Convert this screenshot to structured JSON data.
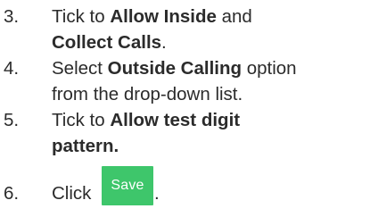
{
  "steps": [
    {
      "number": "3.",
      "lines": [
        {
          "pre": "Tick to ",
          "bold": "Allow Inside",
          "post": " and"
        },
        {
          "pre": "",
          "bold": "Collect Calls",
          "post": "."
        }
      ]
    },
    {
      "number": "4.",
      "lines": [
        {
          "pre": "Select ",
          "bold": "Outside Calling",
          "post": " option"
        },
        {
          "pre": "from the drop-down list.",
          "bold": "",
          "post": ""
        }
      ]
    },
    {
      "number": "5.",
      "lines": [
        {
          "pre": "Tick to ",
          "bold": "Allow test digit",
          "post": ""
        },
        {
          "pre": "",
          "bold": "pattern.",
          "post": ""
        }
      ]
    },
    {
      "number": "6.",
      "pre": "Click",
      "button_label": "Save",
      "post": "."
    }
  ]
}
